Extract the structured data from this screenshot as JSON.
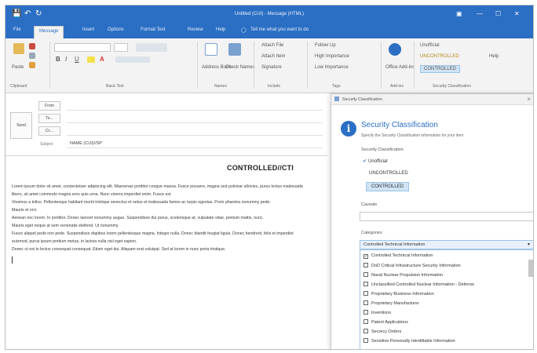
{
  "title_bar": {
    "title": "Untitled (CUI) - Message (HTML)",
    "icons": [
      "save-icon",
      "undo-icon",
      "redo-icon"
    ],
    "window_controls": [
      "ribbon-display-icon",
      "minimize-icon",
      "maximize-icon",
      "close-icon"
    ]
  },
  "tabs": [
    {
      "label": "File"
    },
    {
      "label": "Message"
    },
    {
      "label": "Insert"
    },
    {
      "label": "Options"
    },
    {
      "label": "Format Text"
    },
    {
      "label": "Review"
    },
    {
      "label": "Help"
    },
    {
      "label": "Tell me what you want to do"
    }
  ],
  "ribbon": {
    "paste": "Paste",
    "clipboard": "Clipboard",
    "basic_text": "Basic Text",
    "names": "Names",
    "include": "Include",
    "tags": "Tags",
    "add_ins": "Add-ins",
    "security_group": "Security Classification",
    "address_book": "Address Book",
    "check_names": "Check Names",
    "attach_file": "Attach File",
    "attach_item": "Attach Item",
    "signature": "Signature",
    "follow_up": "Follow Up",
    "high_importance": "High Importance",
    "low_importance": "Low Importance",
    "office_addins": "Office Add-ins",
    "unofficial": "Unofficial",
    "unclassified": "UNCONTROLLED",
    "help": "Help",
    "controlled": "CONTROLLED"
  },
  "header": {
    "from_label": "From",
    "to_label": "To...",
    "cc_label": "Cc...",
    "send_label": "Send",
    "subject_label": "Subject",
    "subject_value": "NAME (CUI)//SP"
  },
  "body": {
    "doc_title": "CONTROLLED//CTI",
    "lines": [
      "Lorem ipsum dolor sit amet, consectetuer adipiscing elit. Maecenas porttitor congue massa. Fusce posuere, magna sed pulvinar ultricies, purus lectus malesuada",
      "libero, sit amet commodo magna eros quis urna. Nunc viverra imperdiet enim. Fusce est.",
      "Vivamus a tellus. Pellentesque habitant morbi tristique senectus et netus et malesuada fames ac turpis egestas. Proin pharetra nonummy pede.",
      "Mauris et orci.",
      "Aenean nec lorem. In porttitor. Donec laoreet nonummy augue. Suspendisse dui purus, scelerisque at, vulputate vitae, pretium mattis, nunc.",
      "Mauris eget neque at sem venenatis eleifend. Ut nonummy.",
      "Fusce aliquet pede non pede. Suspendisse dapibus lorem pellentesque magna. Integer nulla. Donec blandit feugiat ligula. Donec hendrerit, felis et imperdiet",
      "euismod, purus ipsum pretium metus, in lacinia nulla nisl eget sapien.",
      "Donec ut est in lectus consequat consequat. Etiam eget dui. Aliquam erat volutpat. Sed at lorem in nunc porta tristique."
    ]
  },
  "panel": {
    "header_title": "Security Classification",
    "title": "Security Classification",
    "subtitle": "Specify the Security Classification information for your item",
    "classification_label": "Security Classification",
    "options": [
      {
        "label": "Unofficial",
        "checked": true,
        "selected": false
      },
      {
        "label": "UNCONTROLLED",
        "checked": false,
        "selected": false
      },
      {
        "label": "CONTROLLED",
        "checked": false,
        "selected": true
      }
    ],
    "caveats_label": "Caveats",
    "category_label": "Categories",
    "category_value": "Controlled Technical Information",
    "categories": [
      {
        "label": "Controlled Technical Information",
        "checked": true
      },
      {
        "label": "DoD Critical Infrastructure Security Information",
        "checked": false
      },
      {
        "label": "Naval Nuclear Propulsion Information",
        "checked": false
      },
      {
        "label": "Unclassified Controlled Nuclear Information - Defense",
        "checked": false
      },
      {
        "label": "Proprietary Business Information",
        "checked": false
      },
      {
        "label": "Proprietary Manufacturer",
        "checked": false
      },
      {
        "label": "Inventions",
        "checked": false
      },
      {
        "label": "Patent Applications",
        "checked": false
      },
      {
        "label": "Secrecy Orders",
        "checked": false
      },
      {
        "label": "Sensitive Personally Identifiable Information",
        "checked": false
      }
    ]
  },
  "colors": {
    "accent": "#2b6fc4",
    "selected": "#cfe3f5"
  }
}
